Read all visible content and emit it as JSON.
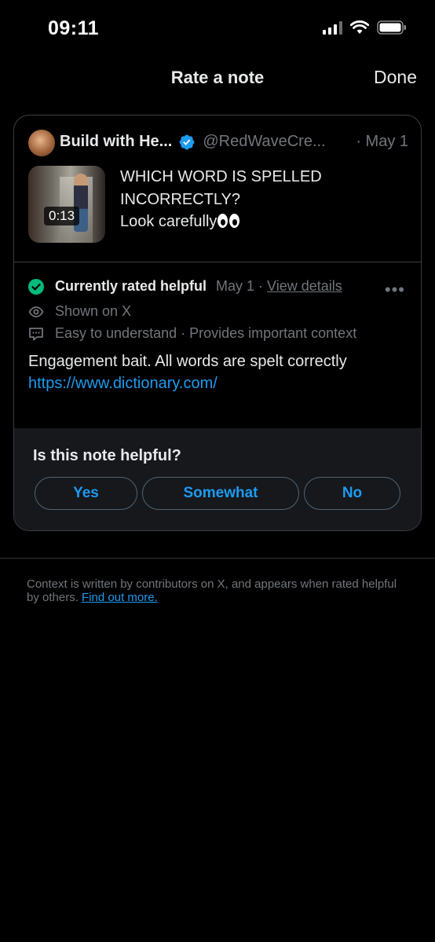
{
  "status_bar": {
    "time": "09:11"
  },
  "nav": {
    "title": "Rate a note",
    "done_label": "Done"
  },
  "tweet": {
    "author_name": "Build with He...",
    "handle": "@RedWaveCre...",
    "date": "· May 1",
    "video_duration": "0:13",
    "text_lines": [
      "WHICH WORD IS SPELLED",
      "INCORRECTLY?",
      "Look carefully"
    ],
    "emoji": "eyes"
  },
  "note": {
    "status_label": "Currently rated helpful",
    "status_date": "May 1 ·",
    "view_details_label": "View details",
    "more_label": "•••",
    "shown_on": "Shown on X",
    "tags": "Easy to understand · Provides important context",
    "body": "Engagement bait. All words are spelt correctly",
    "link": "https://www.dictionary.com/"
  },
  "rating": {
    "question": "Is this note helpful?",
    "options": [
      "Yes",
      "Somewhat",
      "No"
    ]
  },
  "footer": {
    "text": "Context is written by contributors on X, and appears when rated helpful by others.",
    "link_label": "Find out more."
  },
  "colors": {
    "accent": "#1d9bf0",
    "success": "#00ba7c",
    "muted": "#71767b"
  }
}
